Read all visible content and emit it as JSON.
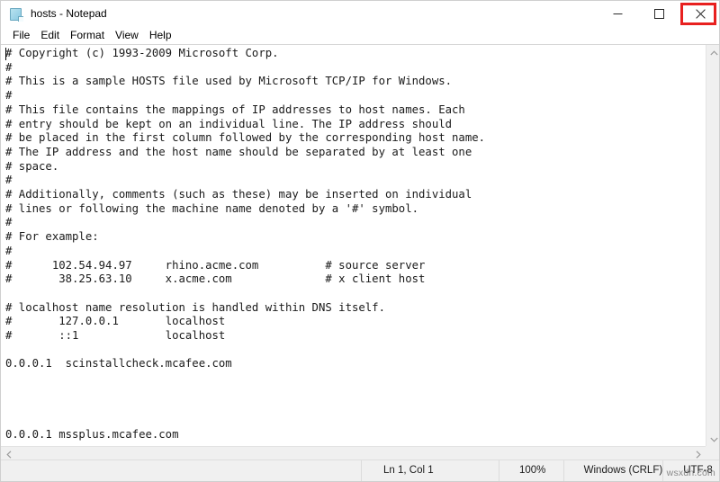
{
  "window": {
    "title": "hosts - Notepad",
    "icon": "notepad-icon",
    "controls": {
      "minimize_label": "Minimize",
      "maximize_label": "Maximize",
      "close_label": "Close"
    },
    "close_highlight_color": "#e8201f"
  },
  "menubar": {
    "items": [
      {
        "label": "File"
      },
      {
        "label": "Edit"
      },
      {
        "label": "Format"
      },
      {
        "label": "View"
      },
      {
        "label": "Help"
      }
    ]
  },
  "editor": {
    "text": "# Copyright (c) 1993-2009 Microsoft Corp.\n#\n# This is a sample HOSTS file used by Microsoft TCP/IP for Windows.\n#\n# This file contains the mappings of IP addresses to host names. Each\n# entry should be kept on an individual line. The IP address should\n# be placed in the first column followed by the corresponding host name.\n# The IP address and the host name should be separated by at least one\n# space.\n#\n# Additionally, comments (such as these) may be inserted on individual\n# lines or following the machine name denoted by a '#' symbol.\n#\n# For example:\n#\n#      102.54.94.97     rhino.acme.com          # source server\n#       38.25.63.10     x.acme.com              # x client host\n\n# localhost name resolution is handled within DNS itself.\n#\t127.0.0.1       localhost\n#\t::1             localhost\n\n0.0.0.1  scinstallcheck.mcafee.com\n\n\n\n\n0.0.0.1 mssplus.mcafee.com",
    "caret_visible": true
  },
  "scrollbars": {
    "vertical_up": "scroll-up-icon",
    "vertical_down": "scroll-down-icon",
    "horizontal_left": "scroll-left-icon",
    "horizontal_right": "scroll-right-icon"
  },
  "statusbar": {
    "cursor_position": "Ln 1, Col 1",
    "zoom": "100%",
    "line_ending": "Windows (CRLF)",
    "encoding": "UTF-8"
  },
  "watermark": {
    "text": "wsxdn.com"
  }
}
